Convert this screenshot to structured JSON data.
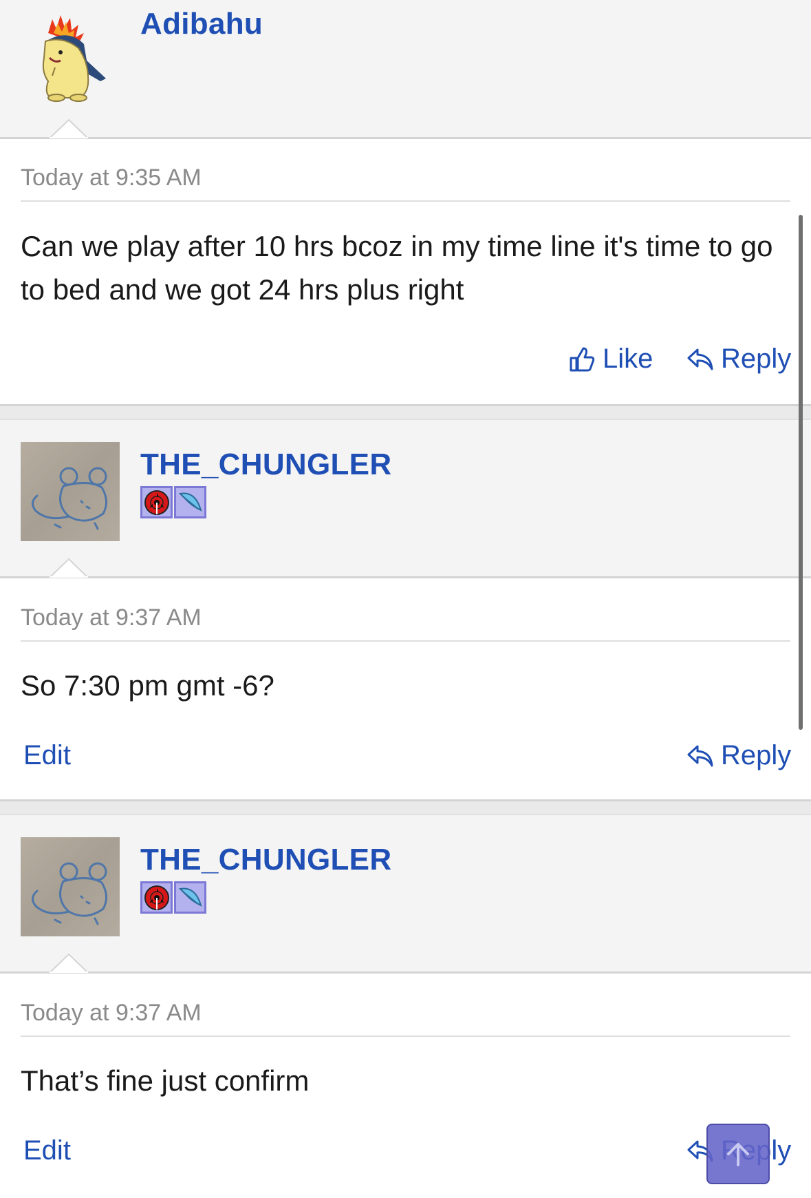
{
  "posts": [
    {
      "username": "Adibahu",
      "timestamp": "Today at 9:35 AM",
      "message": "Can we play after 10 hrs bcoz in my time line it's time to go to bed and we got 24 hrs plus right",
      "actions": {
        "like": "Like",
        "reply": "Reply"
      }
    },
    {
      "username": "THE_CHUNGLER",
      "timestamp": "Today at 9:37 AM",
      "message": "So 7:30 pm gmt -6?",
      "actions": {
        "edit": "Edit",
        "reply": "Reply"
      }
    },
    {
      "username": "THE_CHUNGLER",
      "timestamp": "Today at 9:37 AM",
      "message": "That’s fine just confirm",
      "actions": {
        "edit": "Edit",
        "reply": "Reply"
      }
    }
  ],
  "icons": {
    "like": "thumbs-up-icon",
    "reply": "reply-arrow-icon",
    "scroll_top": "arrow-up-icon"
  },
  "colors": {
    "link": "#1f4fb4",
    "timestamp": "#8a8a8a",
    "header_bg": "#f4f4f4",
    "body_bg": "#ffffff",
    "scroll_top_bg": "#6464c8"
  }
}
